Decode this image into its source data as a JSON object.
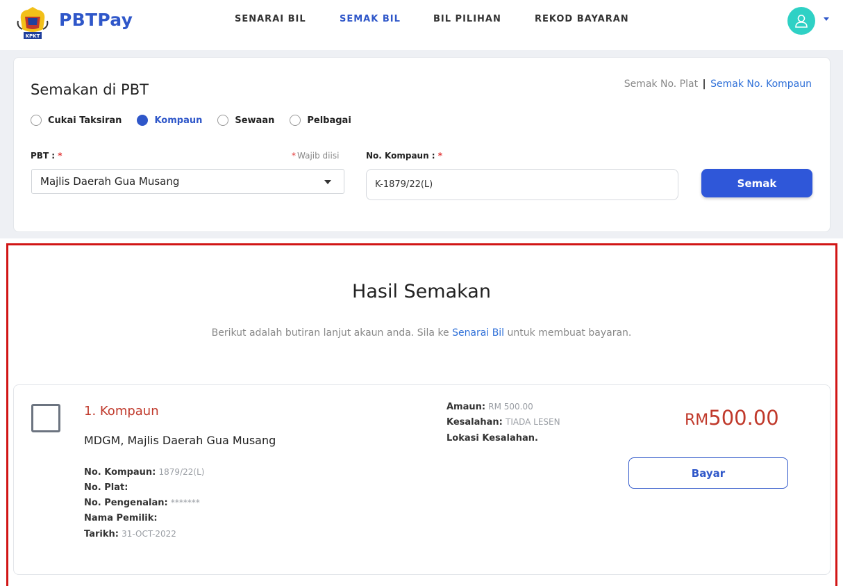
{
  "header": {
    "brand": "PBTPay",
    "crest_caption": "KPKT",
    "nav": [
      {
        "label": "SENARAI BIL"
      },
      {
        "label": "SEMAK BIL"
      },
      {
        "label": "BIL PILIHAN"
      },
      {
        "label": "REKOD BAYARAN"
      }
    ],
    "active_nav": "SEMAK BIL",
    "avatar_color": "#2fd1c5",
    "brand_color": "#2f57c9"
  },
  "search": {
    "title": "Semakan di PBT",
    "link_plate": "Semak No. Plat",
    "link_separator": "|",
    "link_kompaun": "Semak No. Kompaun",
    "radios": [
      {
        "label": "Cukai Taksiran",
        "checked": false
      },
      {
        "label": "Kompaun",
        "checked": true
      },
      {
        "label": "Sewaan",
        "checked": false
      },
      {
        "label": "Pelbagai",
        "checked": false
      }
    ],
    "pbt_label": "PBT :",
    "required_mark": "*",
    "wajib_note": "Wajib diisi",
    "pbt_value": "Majlis Daerah Gua Musang",
    "kompaun_label": "No. Kompaun :",
    "kompaun_value": "K-1879/22(L)",
    "submit_label": "Semak"
  },
  "results": {
    "title": "Hasil Semakan",
    "subtitle_before": "Berikut adalah butiran lanjut akaun anda. Sila ke",
    "subtitle_link": "Senarai Bil",
    "subtitle_after": "untuk membuat bayaran.",
    "highlight_color": "#d11515",
    "bill": {
      "title": "1. Kompaun",
      "org": "MDGM, Majlis Daerah Gua Musang",
      "left_details": [
        {
          "key": "No. Kompaun:",
          "value": "1879/22(L)"
        },
        {
          "key": "No. Plat:",
          "value": ""
        },
        {
          "key": "No. Pengenalan:",
          "value": "*******"
        },
        {
          "key": "Nama Pemilik:",
          "value": ""
        },
        {
          "key": "Tarikh:",
          "value": "31-OCT-2022"
        }
      ],
      "right_details": [
        {
          "key": "Amaun:",
          "value": "RM 500.00"
        },
        {
          "key": "Kesalahan:",
          "value": "TIADA LESEN"
        },
        {
          "key": "Lokasi Kesalahan.",
          "value": ""
        }
      ],
      "amount_currency": "RM",
      "amount_value": "500.00",
      "pay_label": "Bayar"
    }
  }
}
